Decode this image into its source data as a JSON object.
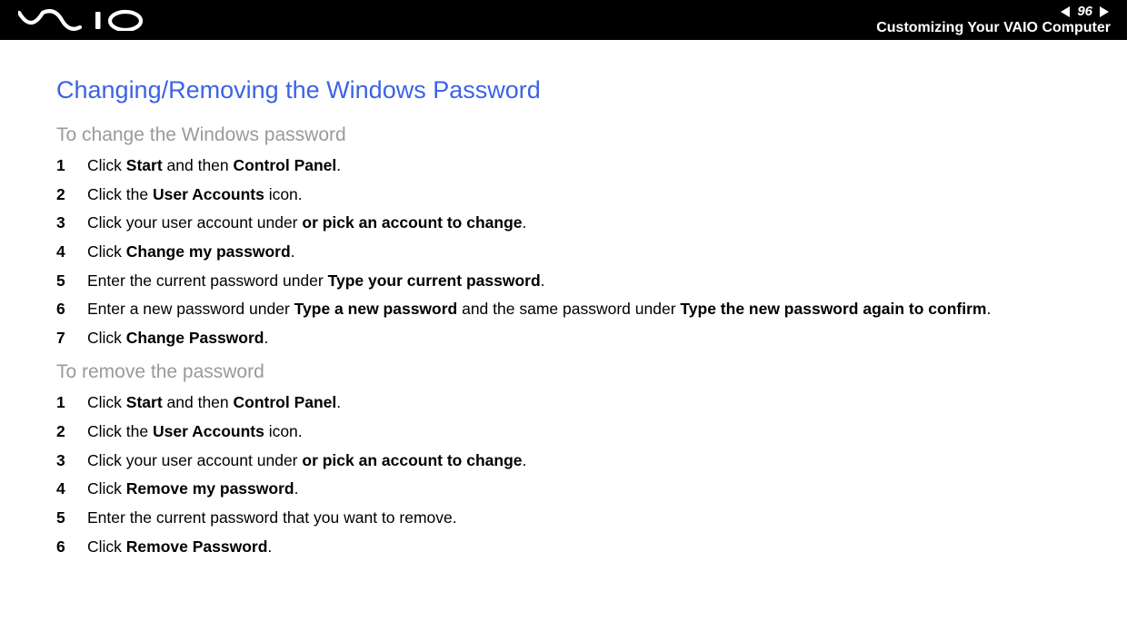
{
  "header": {
    "page_number": "96",
    "section_title": "Customizing Your VAIO Computer"
  },
  "main": {
    "title": "Changing/Removing the Windows Password",
    "subtitle1": "To change the Windows password",
    "steps1": [
      {
        "num": "1",
        "parts": [
          "Click ",
          "Start",
          " and then ",
          "Control Panel",
          "."
        ]
      },
      {
        "num": "2",
        "parts": [
          "Click the ",
          "User Accounts",
          " icon."
        ]
      },
      {
        "num": "3",
        "parts": [
          "Click your user account under ",
          "or pick an account to change",
          "."
        ]
      },
      {
        "num": "4",
        "parts": [
          "Click ",
          "Change my password",
          "."
        ]
      },
      {
        "num": "5",
        "parts": [
          "Enter the current password under ",
          "Type your current password",
          "."
        ]
      },
      {
        "num": "6",
        "parts": [
          "Enter a new password under ",
          "Type a new password",
          " and the same password under ",
          "Type the new password again to confirm",
          "."
        ]
      },
      {
        "num": "7",
        "parts": [
          "Click ",
          "Change Password",
          "."
        ]
      }
    ],
    "subtitle2": "To remove the password",
    "steps2": [
      {
        "num": "1",
        "parts": [
          "Click ",
          "Start",
          " and then ",
          "Control Panel",
          "."
        ]
      },
      {
        "num": "2",
        "parts": [
          "Click the ",
          "User Accounts",
          " icon."
        ]
      },
      {
        "num": "3",
        "parts": [
          "Click your user account under ",
          "or pick an account to change",
          "."
        ]
      },
      {
        "num": "4",
        "parts": [
          "Click ",
          "Remove my password",
          "."
        ]
      },
      {
        "num": "5",
        "parts": [
          "Enter the current password that you want to remove."
        ]
      },
      {
        "num": "6",
        "parts": [
          "Click ",
          "Remove Password",
          "."
        ]
      }
    ]
  }
}
